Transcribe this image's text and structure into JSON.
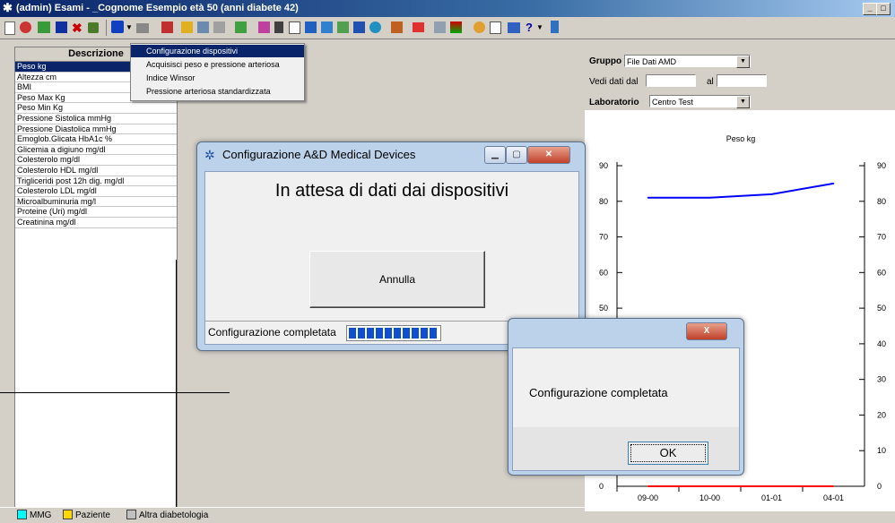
{
  "window": {
    "title": "(admin) Esami - _Cognome Esempio età 50 (anni diabete 42)",
    "min": "_",
    "max": "□",
    "close": "×"
  },
  "left_panel": {
    "header": "Descrizione",
    "items": [
      "Peso kg",
      "Altezza cm",
      "BMI",
      "Peso Max Kg",
      "Peso Min Kg",
      "Pressione Sistolica mmHg",
      "Pressione Diastolica mmHg",
      "Emoglob.Glicata HbA1c %",
      "Glicemia a digiuno mg/dl",
      "Colesterolo mg/dl",
      "Colesterolo HDL mg/dl",
      "Trigliceridi post 12h dig. mg/dl",
      "Colesterolo LDL mg/dl",
      "Microalbuminuria mg/l",
      "Proteine (Uri) mg/dl",
      "Creatinina mg/dl"
    ]
  },
  "menu": {
    "items": [
      "Configurazione dispositivi",
      "Acquisisci peso e pressione arteriosa",
      "Indice Winsor",
      "Pressione arteriosa standardizzata"
    ]
  },
  "filters": {
    "gruppo_label": "Gruppo",
    "gruppo_value": "File Dati AMD",
    "vedi_label": "Vedi dati dal",
    "al_label": "al",
    "lab_label": "Laboratorio",
    "lab_value": "Centro Test"
  },
  "dialog1": {
    "title": "Configurazione A&D Medical Devices",
    "message": "In attesa di dati dai dispositivi",
    "button": "Annulla",
    "status": "Configurazione completata",
    "progress": 1.0
  },
  "dialog2": {
    "message": "Configurazione completata",
    "button": "OK",
    "close": "X"
  },
  "legend": {
    "items": [
      {
        "label": "MMG",
        "color": "#00ffff"
      },
      {
        "label": "Paziente",
        "color": "#ffd700"
      },
      {
        "label": "Altra diabetologia",
        "color": "#c0c0c0"
      }
    ]
  },
  "chart_data": {
    "type": "line",
    "title": "Peso kg",
    "ylim": [
      0,
      90
    ],
    "yticks": [
      0,
      10,
      20,
      30,
      40,
      50,
      60,
      70,
      80,
      90
    ],
    "categories": [
      "09-00",
      "10-00",
      "01-01",
      "04-01"
    ],
    "series": [
      {
        "values": [
          81,
          81,
          82,
          85
        ],
        "color": "#0000ff"
      },
      {
        "values": [
          0,
          0,
          0,
          0
        ],
        "color": "#ff0000"
      }
    ]
  }
}
